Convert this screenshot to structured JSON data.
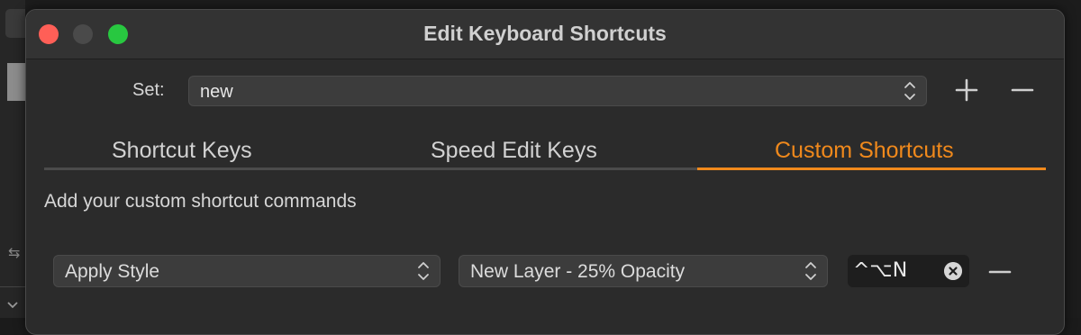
{
  "window": {
    "title": "Edit Keyboard Shortcuts"
  },
  "set": {
    "label": "Set:",
    "value": "new"
  },
  "tabs": [
    {
      "label": "Shortcut Keys",
      "selected": false
    },
    {
      "label": "Speed Edit Keys",
      "selected": false
    },
    {
      "label": "Custom Shortcuts",
      "selected": true
    }
  ],
  "custom": {
    "description": "Add your custom shortcut commands",
    "rows": [
      {
        "command": "Apply Style",
        "target": "New Layer - 25% Opacity",
        "shortcut": "^⌥N"
      }
    ]
  },
  "colors": {
    "accent": "#f0891c",
    "close": "#ff5f57",
    "zoom": "#28c840",
    "window_bg": "#2b2b2b"
  },
  "icons": [
    "sliders-icon",
    "chevron-down-icon",
    "updown-chevron-icon",
    "plus-icon",
    "minus-icon",
    "clear-icon"
  ]
}
